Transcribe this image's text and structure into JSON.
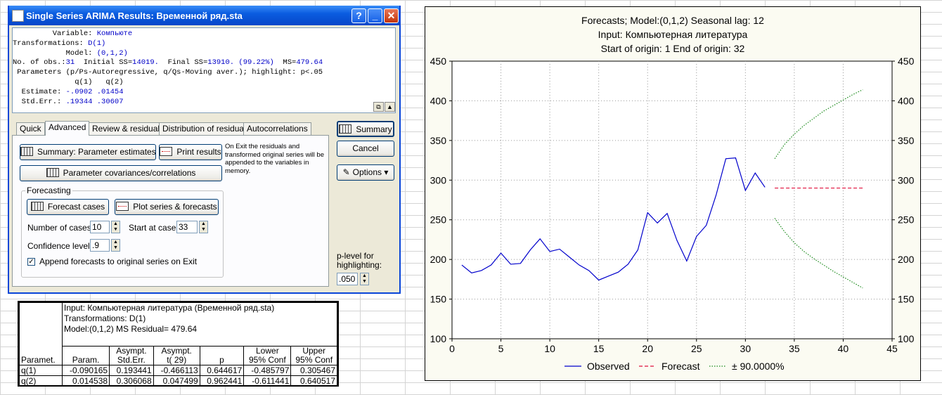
{
  "window": {
    "title": "Single Series ARIMA Results: Временной ряд.sta",
    "help_label": "?",
    "min_label": "_",
    "close_label": "✕"
  },
  "results": {
    "line1": "         Variable: ",
    "line1_val": "Компьюте",
    "line2": "Transformations: ",
    "line2_val": "D(1)",
    "line3": "            Model: ",
    "line3_val": "(0,1,2)",
    "line4_a": "No. of obs.:",
    "line4_b": "31",
    "line4_c": "  Initial SS=",
    "line4_d": "14019.",
    "line4_e": "  Final SS=",
    "line4_f": "13910. (99.22%)",
    "line4_g": "  MS=",
    "line4_h": "479.64",
    "line5": " Parameters (p/Ps-Autoregressive, q/Qs-Moving aver.); highlight: p<.05",
    "line6": "              q(1)   q(2)",
    "line7": "  Estimate: ",
    "line7_val": "-.0902 .01454",
    "line8": "  Std.Err.: ",
    "line8_val": ".19344 .30607"
  },
  "tabs": [
    "Quick",
    "Advanced",
    "Review & residuals",
    "Distribution of residuals",
    "Autocorrelations"
  ],
  "buttons": {
    "summary_param": "Summary:  Parameter estimates",
    "print_results": "Print results",
    "param_cov": "Parameter covariances/correlations",
    "forecast_cases": "Forecast cases",
    "plot_series": "Plot series & forecasts",
    "summary": "Summary",
    "cancel": "Cancel",
    "options": "Options ▾"
  },
  "exit_note": "On Exit the residuals and\ntransformed original series will be\nappended to the variables in\nmemory.",
  "forecasting": {
    "group_label": "Forecasting",
    "num_cases_label": "Number of cases:",
    "num_cases_value": "10",
    "start_at_label": "Start at case:",
    "start_at_value": "33",
    "confidence_label": "Confidence level:",
    "confidence_value": ".9",
    "append_label": "Append forecasts to original series on Exit",
    "append_checked": true
  },
  "plevel": {
    "label1": "p-level for",
    "label2": "highlighting:",
    "value": ".050"
  },
  "table": {
    "head1": "Input: Компьютерная литература (Временной ряд.sta)",
    "head2": "Transformations: D(1)",
    "head3": "Model:(0,1,2) MS Residual= 479.64",
    "col0": "Paramet.",
    "cols": [
      [
        "Param.",
        ""
      ],
      [
        "Asympt.",
        "Std.Err."
      ],
      [
        "Asympt.",
        "t(   29)"
      ],
      [
        "p",
        ""
      ],
      [
        "Lower",
        "95% Conf"
      ],
      [
        "Upper",
        "95% Conf"
      ]
    ],
    "rows": [
      {
        "name": "q(1)",
        "vals": [
          "-0.090165",
          "0.193441",
          "-0.466113",
          "0.644617",
          "-0.485797",
          "0.305467"
        ]
      },
      {
        "name": "q(2)",
        "vals": [
          "0.014538",
          "0.306068",
          "0.047499",
          "0.962441",
          "-0.611441",
          "0.640517"
        ]
      }
    ]
  },
  "chart_data": {
    "type": "line",
    "title_lines": [
      "Forecasts; Model:(0,1,2) Seasonal lag: 12",
      "Input: Компьютерная литература",
      "Start of origin: 1        End of origin: 32"
    ],
    "xlim": [
      0,
      45
    ],
    "ylim": [
      100,
      450
    ],
    "xticks": [
      0,
      5,
      10,
      15,
      20,
      25,
      30,
      35,
      40,
      45
    ],
    "yticks": [
      100,
      150,
      200,
      250,
      300,
      350,
      400,
      450
    ],
    "grid": true,
    "legend_position": "bottom",
    "series": [
      {
        "name": "Observed",
        "color": "#0000cc",
        "style": "solid",
        "x": [
          1,
          2,
          3,
          4,
          5,
          6,
          7,
          8,
          9,
          10,
          11,
          12,
          13,
          14,
          15,
          16,
          17,
          18,
          19,
          20,
          21,
          22,
          23,
          24,
          25,
          26,
          27,
          28,
          29,
          30,
          31,
          32
        ],
        "y": [
          193,
          183,
          186,
          193,
          208,
          194,
          195,
          212,
          226,
          210,
          213,
          203,
          193,
          186,
          174,
          179,
          184,
          194,
          212,
          259,
          246,
          258,
          224,
          198,
          229,
          243,
          281,
          327,
          328,
          287,
          309,
          291
        ]
      },
      {
        "name": "Forecast",
        "color": "#e0103c",
        "style": "dashed",
        "x": [
          33,
          34,
          35,
          36,
          37,
          38,
          39,
          40,
          41,
          42
        ],
        "y": [
          290,
          290,
          290,
          290,
          290,
          290,
          290,
          290,
          290,
          290
        ]
      },
      {
        "name": "± 90.0000%",
        "color": "#1a8a1a",
        "style": "dotted",
        "x": [
          33,
          34,
          35,
          36,
          37,
          38,
          39,
          40,
          41,
          42
        ],
        "y_upper": [
          327,
          345,
          358,
          369,
          378,
          387,
          394,
          401,
          408,
          414
        ],
        "y_lower": [
          252,
          235,
          221,
          210,
          201,
          193,
          185,
          178,
          171,
          164
        ]
      }
    ]
  }
}
